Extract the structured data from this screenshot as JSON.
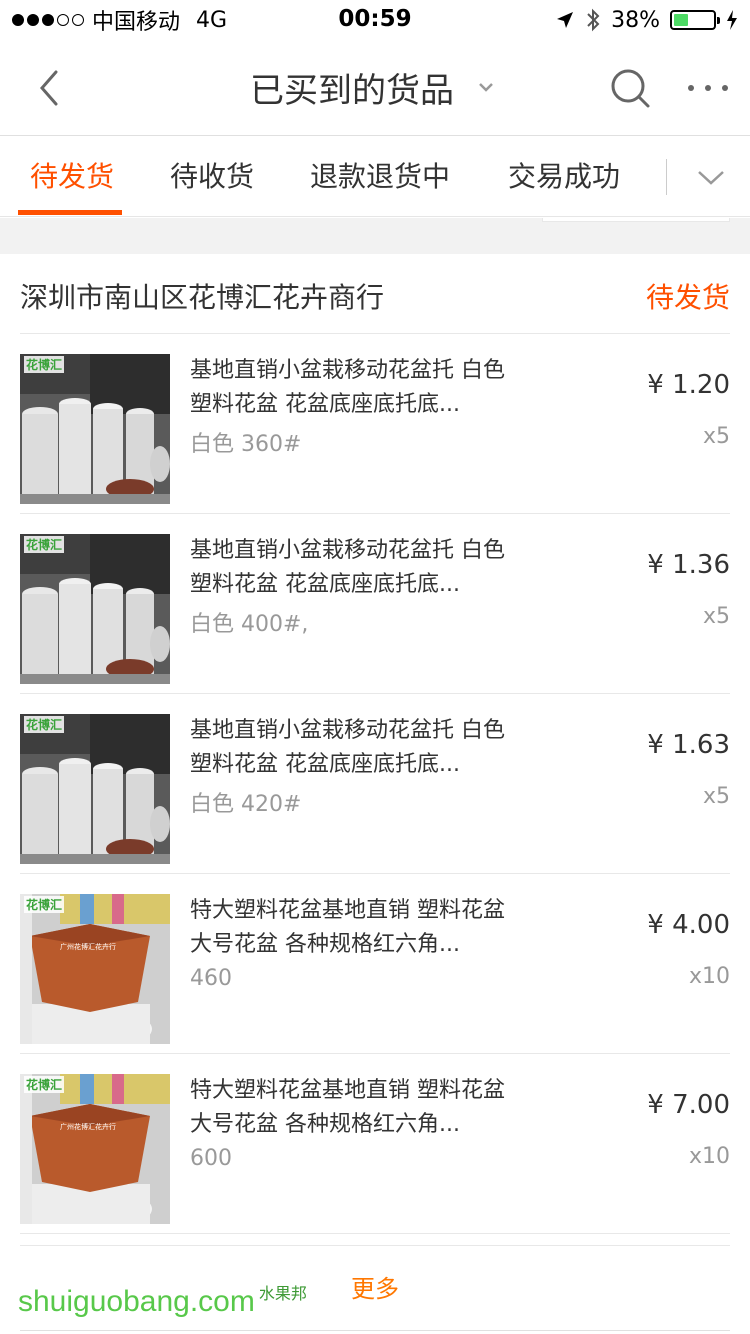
{
  "status_bar": {
    "carrier": "中国移动",
    "network": "4G",
    "time": "00:59",
    "battery_percent": "38%",
    "battery_level": 0.38,
    "signal_bars_filled": 3,
    "signal_bars_total": 5
  },
  "nav": {
    "title": "已买到的货品",
    "back_icon": "chevron-left-icon",
    "search_icon": "search-icon",
    "more_icon": "ellipsis-icon"
  },
  "tabs": {
    "items": [
      {
        "label": "待发货",
        "active": true
      },
      {
        "label": "待收货",
        "active": false
      },
      {
        "label": "退款退货中",
        "active": false
      },
      {
        "label": "交易成功",
        "active": false
      }
    ],
    "accent_color": "#ff5000"
  },
  "shop": {
    "name": "深圳市南山区花博汇花卉商行",
    "status": "待发货"
  },
  "items": [
    {
      "title": "基地直销小盆栽移动花盆托 白色 塑料花盆 花盆底座底托底...",
      "spec": "白色 360#",
      "price": "¥ 1.20",
      "qty": "x5",
      "thumb": "white-pot-trays"
    },
    {
      "title": "基地直销小盆栽移动花盆托 白色 塑料花盆 花盆底座底托底...",
      "spec": "白色 400#,",
      "price": "¥ 1.36",
      "qty": "x5",
      "thumb": "white-pot-trays"
    },
    {
      "title": "基地直销小盆栽移动花盆托 白色 塑料花盆 花盆底座底托底...",
      "spec": "白色 420#",
      "price": "¥ 1.63",
      "qty": "x5",
      "thumb": "white-pot-trays"
    },
    {
      "title": "特大塑料花盆基地直销 塑料花盆大号花盆 各种规格红六角...",
      "spec": "460",
      "price": "¥ 4.00",
      "qty": "x10",
      "thumb": "hexagon-red-pot"
    },
    {
      "title": "特大塑料花盆基地直销 塑料花盆大号花盆 各种规格红六角...",
      "spec": "600",
      "price": "¥ 7.00",
      "qty": "x10",
      "thumb": "hexagon-red-pot"
    }
  ],
  "thumb_logo": "花博汇",
  "pot_label": "广州花博汇花卉行",
  "more_label": "更多",
  "watermark": {
    "main": "shuiguobang",
    "dot_com": ".com",
    "cn": "水果邦"
  }
}
